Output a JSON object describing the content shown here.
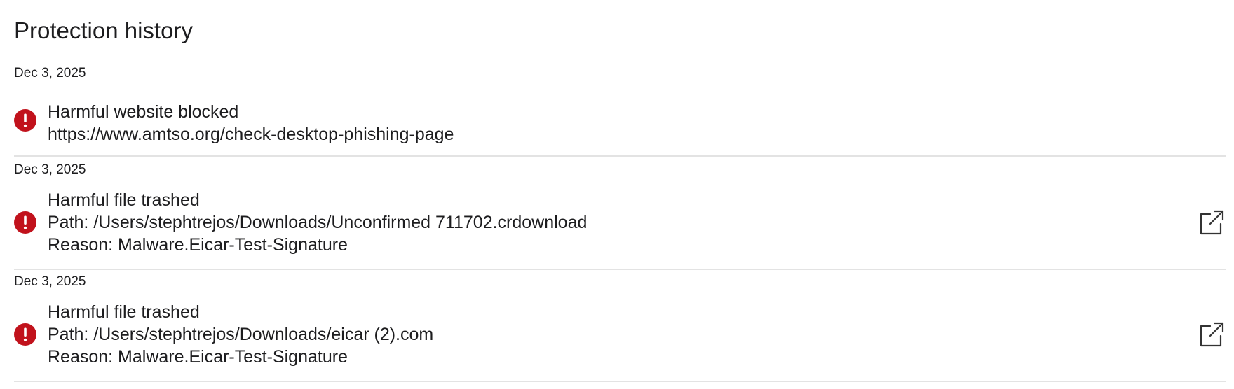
{
  "page": {
    "title": "Protection history"
  },
  "colors": {
    "alert": "#c1121c",
    "divider": "#e3e3e3",
    "text": "#1d1d1f"
  },
  "items": [
    {
      "date": "Dec 3, 2025",
      "heading": "Harmful website blocked",
      "detail": "https://www.amtso.org/check-desktop-phishing-page",
      "reason": "",
      "status_icon": "alert-icon",
      "action_icon": ""
    },
    {
      "date": "Dec 3, 2025",
      "heading": "Harmful file trashed",
      "detail": "Path: /Users/stephtrejos/Downloads/Unconfirmed 711702.crdownload",
      "reason": "Reason: Malware.Eicar-Test-Signature",
      "status_icon": "alert-icon",
      "action_icon": "open-external-icon"
    },
    {
      "date": "Dec 3, 2025",
      "heading": "Harmful file trashed",
      "detail": "Path: /Users/stephtrejos/Downloads/eicar (2).com",
      "reason": "Reason: Malware.Eicar-Test-Signature",
      "status_icon": "alert-icon",
      "action_icon": "open-external-icon"
    }
  ]
}
